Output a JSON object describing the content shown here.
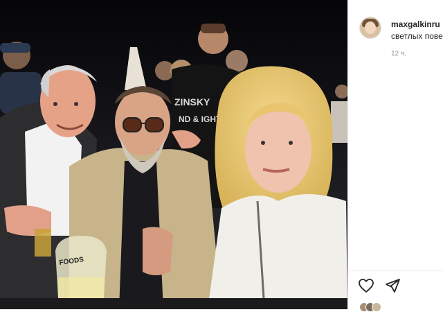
{
  "post": {
    "username": "maxgalkinru",
    "caption": "светлых пове",
    "time": "12 ч."
  },
  "photo": {
    "sign_text": "ZINSKY",
    "shirt_text": "ND & IGHT",
    "glass_text": "FOODS"
  },
  "icons": {
    "like": "heart-icon",
    "share": "send-icon"
  }
}
